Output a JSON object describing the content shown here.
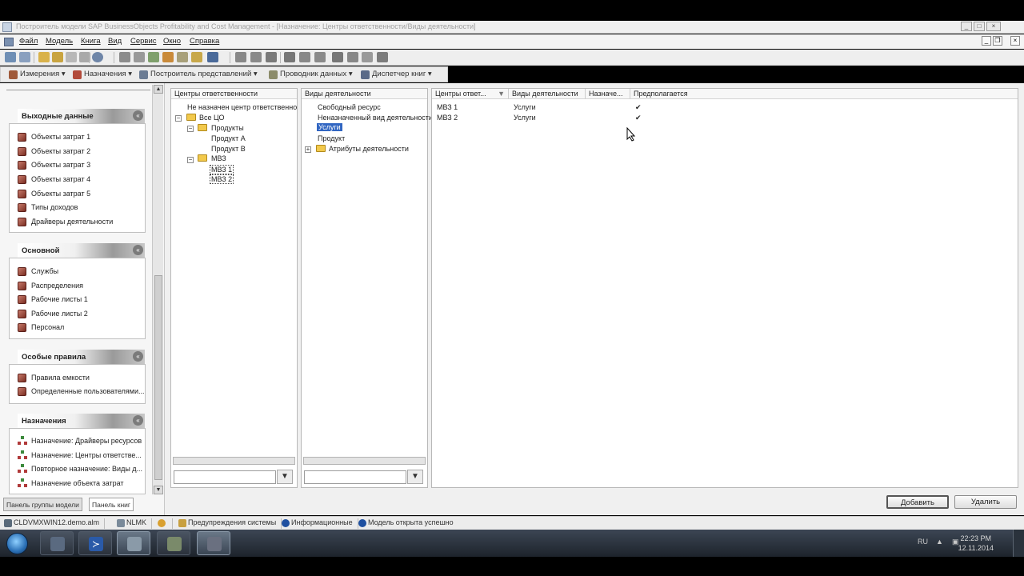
{
  "window": {
    "title": "Построитель модели SAP BusinessObjects Profitability and Cost Management - [Назначение: Центры ответственности/Виды деятельности]",
    "minimize": "_",
    "maximize": "□",
    "close": "×"
  },
  "menu": {
    "items": [
      "Файл",
      "Модель",
      "Книга",
      "Вид",
      "Сервис",
      "Окно",
      "Справка"
    ],
    "mdi_minimize": "_",
    "mdi_restore": "❐",
    "mdi_close": "×"
  },
  "toolbar2": {
    "buttons": [
      "Измерения",
      "Назначения",
      "Построитель представлений",
      "Проводник данных",
      "Диспетчер книг"
    ]
  },
  "left_panel": {
    "groups": [
      {
        "title": "Выходные данные",
        "items": [
          "Объекты затрат 1",
          "Объекты затрат 2",
          "Объекты затрат 3",
          "Объекты затрат 4",
          "Объекты затрат 5",
          "Типы доходов",
          "Драйверы деятельности"
        ]
      },
      {
        "title": "Основной",
        "items": [
          "Службы",
          "Распределения",
          "Рабочие листы 1",
          "Рабочие листы 2",
          "Персонал"
        ]
      },
      {
        "title": "Особые правила",
        "items": [
          "Правила емкости",
          "Определенные пользователями..."
        ]
      },
      {
        "title": "Назначения",
        "items": [
          "Назначение: Драйверы ресурсов",
          "Назначение: Центры ответстве...",
          "Повторное назначение: Виды д...",
          "Назначение объекта затрат"
        ]
      }
    ],
    "tabs": [
      "Панель группы модели",
      "Панель книг"
    ]
  },
  "cc_panel": {
    "header": "Центры ответственности",
    "tree": [
      "Не назначен центр ответственно",
      "Все ЦО",
      "Продукты",
      "Продукт A",
      "Продукт B",
      "МВЗ",
      "МВЗ 1",
      "МВЗ 2"
    ]
  },
  "act_panel": {
    "header": "Виды деятельности",
    "tree": [
      "Свободный ресурс",
      "Неназначенный вид деятельности",
      "Услуги",
      "Продукт",
      "Атрибуты деятельности"
    ]
  },
  "grid": {
    "headers": [
      "Центры ответ...",
      "Виды деятельности",
      "Назначе...",
      "Предполагается"
    ],
    "rows": [
      {
        "cc": "МВЗ 1",
        "activity": "Услуги",
        "assign": "",
        "assumed": "✔"
      },
      {
        "cc": "МВЗ 2",
        "activity": "Услуги",
        "assign": "",
        "assumed": "✔"
      }
    ],
    "add_label": "Добавить",
    "delete_label": "Удалить"
  },
  "status": {
    "items": [
      "CLDVMXWIN12.demo.alm",
      "NLMK",
      "Предупреждения системы",
      "Информационные",
      "Модель открыта успешно"
    ]
  },
  "taskbar": {
    "lang": "RU",
    "time": "22:23 PM",
    "date": "12.11.2014"
  },
  "colors": {
    "accent_select": "#3166c2",
    "cube_icon": "#8a3a2e",
    "folder": "#f2c94c"
  }
}
